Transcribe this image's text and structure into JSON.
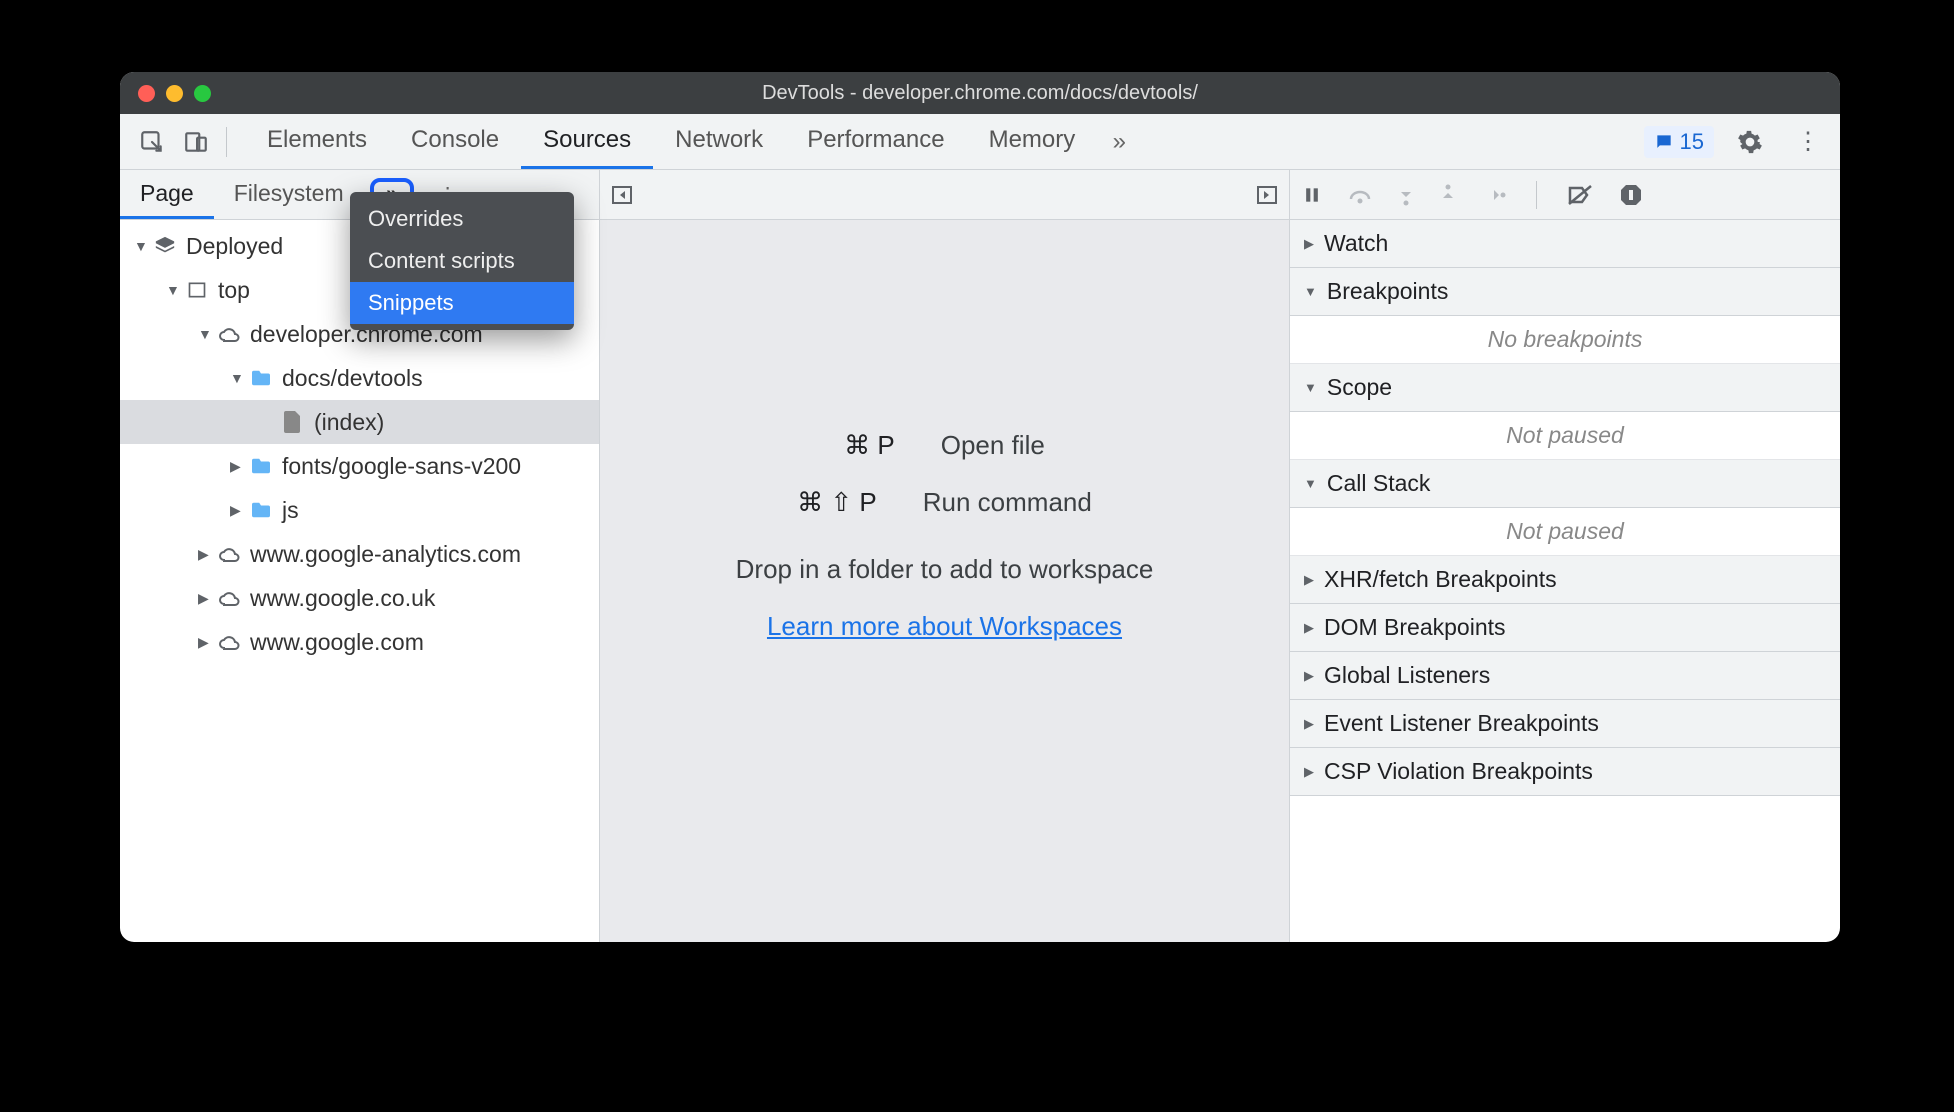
{
  "title": "DevTools - developer.chrome.com/docs/devtools/",
  "tabs": [
    "Elements",
    "Console",
    "Sources",
    "Network",
    "Performance",
    "Memory"
  ],
  "active_tab": "Sources",
  "issues_count": "15",
  "nav_tabs": [
    "Page",
    "Filesystem"
  ],
  "active_nav_tab": "Page",
  "dropdown": {
    "items": [
      "Overrides",
      "Content scripts",
      "Snippets"
    ],
    "hover": "Snippets"
  },
  "tree": [
    {
      "depth": 0,
      "arrow": "down",
      "icon": "deployed",
      "label": "Deployed"
    },
    {
      "depth": 1,
      "arrow": "down",
      "icon": "frame",
      "label": "top"
    },
    {
      "depth": 2,
      "arrow": "down",
      "icon": "cloud",
      "label": "developer.chrome.com"
    },
    {
      "depth": 3,
      "arrow": "down",
      "icon": "folder",
      "label": "docs/devtools"
    },
    {
      "depth": 4,
      "arrow": "",
      "icon": "file",
      "label": "(index)",
      "selected": true
    },
    {
      "depth": 3,
      "arrow": "right",
      "icon": "folder",
      "label": "fonts/google-sans-v200"
    },
    {
      "depth": 3,
      "arrow": "right",
      "icon": "folder",
      "label": "js"
    },
    {
      "depth": 2,
      "arrow": "right",
      "icon": "cloud",
      "label": "www.google-analytics.com"
    },
    {
      "depth": 2,
      "arrow": "right",
      "icon": "cloud",
      "label": "www.google.co.uk"
    },
    {
      "depth": 2,
      "arrow": "right",
      "icon": "cloud",
      "label": "www.google.com"
    }
  ],
  "center": {
    "open_file_keys": "⌘ P",
    "open_file_label": "Open file",
    "run_cmd_keys": "⌘ ⇧ P",
    "run_cmd_label": "Run command",
    "drop_hint": "Drop in a folder to add to workspace",
    "learn_more": "Learn more about Workspaces"
  },
  "debug_sections": [
    {
      "label": "Watch",
      "arrow": "right"
    },
    {
      "label": "Breakpoints",
      "arrow": "down",
      "body": "No breakpoints"
    },
    {
      "label": "Scope",
      "arrow": "down",
      "body": "Not paused"
    },
    {
      "label": "Call Stack",
      "arrow": "down",
      "body": "Not paused"
    },
    {
      "label": "XHR/fetch Breakpoints",
      "arrow": "right"
    },
    {
      "label": "DOM Breakpoints",
      "arrow": "right"
    },
    {
      "label": "Global Listeners",
      "arrow": "right"
    },
    {
      "label": "Event Listener Breakpoints",
      "arrow": "right"
    },
    {
      "label": "CSP Violation Breakpoints",
      "arrow": "right"
    }
  ]
}
